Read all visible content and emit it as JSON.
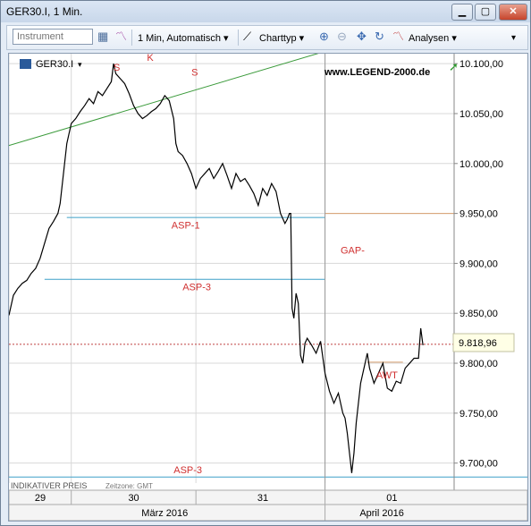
{
  "window": {
    "title": "GER30.I, 1 Min.",
    "min_glyph": "▁",
    "max_glyph": "▢",
    "close_glyph": "✕"
  },
  "toolbar": {
    "instrument_placeholder": "Instrument",
    "interval_label": "1 Min, Automatisch",
    "charttype_label": "Charttyp",
    "analysis_label": "Analysen",
    "dropdown_glyph": "▾"
  },
  "chart_header": {
    "symbol": "GER30.I",
    "watermark": "www.LEGEND-2000.de"
  },
  "chart_data": {
    "type": "line",
    "ylim": [
      9680,
      10110
    ],
    "y_ticks": [
      "10.100,00",
      "10.050,00",
      "10.000,00",
      "9.950,00",
      "9.900,00",
      "9.850,00",
      "9.800,00",
      "9.750,00",
      "9.700,00"
    ],
    "y_tick_values": [
      10100,
      10050,
      10000,
      9950,
      9900,
      9850,
      9800,
      9750,
      9700
    ],
    "x_day_labels": [
      "29",
      "30",
      "31",
      "01"
    ],
    "x_month_labels": [
      "März 2016",
      "April 2016"
    ],
    "last_price": "9.818,96",
    "last_value": 9818.96,
    "annotations": [
      "S",
      "K",
      "S",
      "ASP-1",
      "ASP-3",
      "GAP-",
      "AWT",
      "ASP-3"
    ],
    "footer_left": "INDIKATIVER PREIS",
    "footer_tz": "Zeitzone: GMT",
    "levels": {
      "asp1": 9946,
      "asp3_upper": 9884,
      "asp3_lower": 9686,
      "gap": 9950,
      "awt": 9801,
      "last": 9818.96
    },
    "trendline": [
      {
        "x": 0.0,
        "y": 10018
      },
      {
        "x": 0.7,
        "y": 10111
      }
    ],
    "price_path": [
      [
        0.0,
        9848
      ],
      [
        0.01,
        9868
      ],
      [
        0.02,
        9875
      ],
      [
        0.03,
        9880
      ],
      [
        0.04,
        9883
      ],
      [
        0.05,
        9890
      ],
      [
        0.06,
        9895
      ],
      [
        0.07,
        9905
      ],
      [
        0.08,
        9920
      ],
      [
        0.09,
        9935
      ],
      [
        0.1,
        9942
      ],
      [
        0.11,
        9950
      ],
      [
        0.115,
        9960
      ],
      [
        0.125,
        10000
      ],
      [
        0.13,
        10020
      ],
      [
        0.14,
        10040
      ],
      [
        0.15,
        10045
      ],
      [
        0.16,
        10052
      ],
      [
        0.17,
        10058
      ],
      [
        0.18,
        10065
      ],
      [
        0.19,
        10060
      ],
      [
        0.2,
        10072
      ],
      [
        0.21,
        10068
      ],
      [
        0.22,
        10075
      ],
      [
        0.23,
        10082
      ],
      [
        0.235,
        10100
      ],
      [
        0.24,
        10090
      ],
      [
        0.25,
        10085
      ],
      [
        0.26,
        10080
      ],
      [
        0.27,
        10070
      ],
      [
        0.28,
        10058
      ],
      [
        0.29,
        10050
      ],
      [
        0.3,
        10045
      ],
      [
        0.31,
        10048
      ],
      [
        0.32,
        10052
      ],
      [
        0.33,
        10055
      ],
      [
        0.34,
        10060
      ],
      [
        0.35,
        10068
      ],
      [
        0.36,
        10063
      ],
      [
        0.37,
        10045
      ],
      [
        0.375,
        10020
      ],
      [
        0.38,
        10012
      ],
      [
        0.39,
        10008
      ],
      [
        0.4,
        10000
      ],
      [
        0.41,
        9990
      ],
      [
        0.42,
        9975
      ],
      [
        0.43,
        9985
      ],
      [
        0.44,
        9990
      ],
      [
        0.45,
        9995
      ],
      [
        0.46,
        9985
      ],
      [
        0.47,
        9992
      ],
      [
        0.48,
        10000
      ],
      [
        0.49,
        9988
      ],
      [
        0.5,
        9975
      ],
      [
        0.51,
        9990
      ],
      [
        0.52,
        9982
      ],
      [
        0.53,
        9985
      ],
      [
        0.54,
        9978
      ],
      [
        0.55,
        9970
      ],
      [
        0.56,
        9958
      ],
      [
        0.57,
        9975
      ],
      [
        0.58,
        9968
      ],
      [
        0.59,
        9980
      ],
      [
        0.6,
        9972
      ],
      [
        0.61,
        9950
      ],
      [
        0.62,
        9940
      ],
      [
        0.625,
        9944
      ],
      [
        0.63,
        9950
      ],
      [
        0.633,
        9950
      ],
      [
        0.636,
        9855
      ],
      [
        0.64,
        9845
      ],
      [
        0.645,
        9870
      ],
      [
        0.65,
        9860
      ],
      [
        0.655,
        9808
      ],
      [
        0.66,
        9800
      ],
      [
        0.665,
        9820
      ],
      [
        0.67,
        9825
      ],
      [
        0.68,
        9818
      ],
      [
        0.69,
        9810
      ],
      [
        0.7,
        9822
      ],
      [
        0.71,
        9790
      ],
      [
        0.72,
        9772
      ],
      [
        0.73,
        9760
      ],
      [
        0.74,
        9770
      ],
      [
        0.75,
        9750
      ],
      [
        0.755,
        9745
      ],
      [
        0.76,
        9730
      ],
      [
        0.765,
        9710
      ],
      [
        0.77,
        9690
      ],
      [
        0.775,
        9710
      ],
      [
        0.78,
        9740
      ],
      [
        0.785,
        9760
      ],
      [
        0.79,
        9780
      ],
      [
        0.8,
        9800
      ],
      [
        0.805,
        9810
      ],
      [
        0.81,
        9795
      ],
      [
        0.82,
        9780
      ],
      [
        0.83,
        9790
      ],
      [
        0.84,
        9800
      ],
      [
        0.85,
        9775
      ],
      [
        0.86,
        9772
      ],
      [
        0.87,
        9782
      ],
      [
        0.88,
        9780
      ],
      [
        0.89,
        9795
      ],
      [
        0.9,
        9800
      ],
      [
        0.91,
        9805
      ],
      [
        0.92,
        9805
      ],
      [
        0.925,
        9835
      ],
      [
        0.93,
        9818
      ]
    ]
  },
  "colors": {
    "price": "#000000",
    "trendline": "#3a9a3a",
    "asp_line": "#3fa0c8",
    "gap_line": "#d8a070",
    "last_price_line": "#c04040",
    "annotation": "#d03030",
    "watermark": "#000000",
    "grid": "#d8d8d8"
  }
}
